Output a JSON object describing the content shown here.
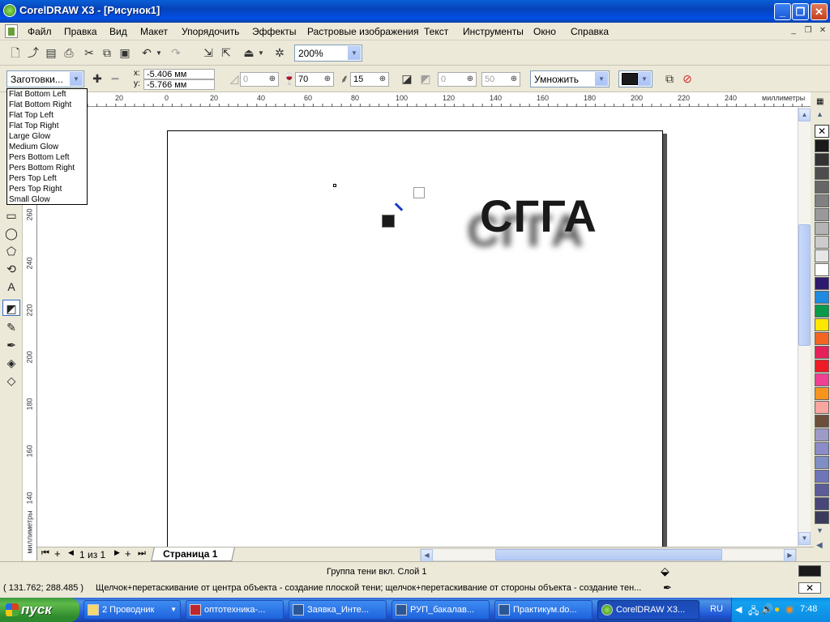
{
  "window": {
    "title": "CorelDRAW X3 - [Рисунок1]"
  },
  "menu": [
    "Файл",
    "Правка",
    "Вид",
    "Макет",
    "Упорядочить",
    "Эффекты",
    "Растровые изображения",
    "Текст",
    "Инструменты",
    "Окно",
    "Справка"
  ],
  "toolbar": {
    "zoom": "200%"
  },
  "property_bar": {
    "preset": "Заготовки...",
    "x_label": "x:",
    "x_value": "-5.406 мм",
    "y_label": "y:",
    "y_value": "-5.766 мм",
    "angle_value": "0",
    "opacity_value": "70",
    "feather_value": "15",
    "stretch_value": "0",
    "fade_value": "50",
    "blend_mode": "Умножить",
    "shadow_color": "#1a1a1a"
  },
  "presets_list": [
    "Flat Bottom Left",
    "Flat Bottom Right",
    "Flat Top Left",
    "Flat Top Right",
    "Large Glow",
    "Medium Glow",
    "Pers Bottom Left",
    "Pers Bottom Right",
    "Pers Top Left",
    "Pers Top Right",
    "Small Glow"
  ],
  "ruler_h": {
    "labels": [
      "20",
      "0",
      "20",
      "40",
      "60",
      "80",
      "100",
      "120",
      "140",
      "160",
      "180",
      "200",
      "220",
      "240"
    ],
    "unit": "миллиметры"
  },
  "ruler_v": {
    "labels": [
      "260",
      "240",
      "220",
      "200",
      "180",
      "160",
      "140"
    ],
    "unit": "миллиметры"
  },
  "canvas": {
    "text": "СГГА"
  },
  "page_nav": {
    "counter": "1 из 1",
    "tab": "Страница 1"
  },
  "status": {
    "object_info": "Группа тени вкл. Слой 1",
    "coords": "( 131.762; 288.485 )",
    "hint": "Щелчок+перетаскивание от центра объекта - создание плоской тени; щелчок+перетаскивание от стороны объекта - создание тен..."
  },
  "palette": [
    "#1a1a1a",
    "#333333",
    "#4d4d4d",
    "#666666",
    "#808080",
    "#999999",
    "#b3b3b3",
    "#cccccc",
    "#e6e6e6",
    "#ffffff",
    "#2e1a6e",
    "#1f8ae0",
    "#0a9a4a",
    "#ffe600",
    "#f26522",
    "#e62058",
    "#ed1c24",
    "#ef4094",
    "#f7941d",
    "#f7a6a0",
    "#6b4f3a",
    "#9e9ac8",
    "#8c8cc8",
    "#7f8fc4",
    "#6f76b8",
    "#5c5c99",
    "#47477a",
    "#3b3b5c"
  ],
  "taskbar": {
    "start": "пуск",
    "tasks": [
      "2 Проводник",
      "оптотехника-...",
      "Заявка_Инте...",
      "РУП_бакалав...",
      "Практикум.do...",
      "CorelDRAW X3..."
    ],
    "lang": "RU",
    "clock": "7:48"
  }
}
